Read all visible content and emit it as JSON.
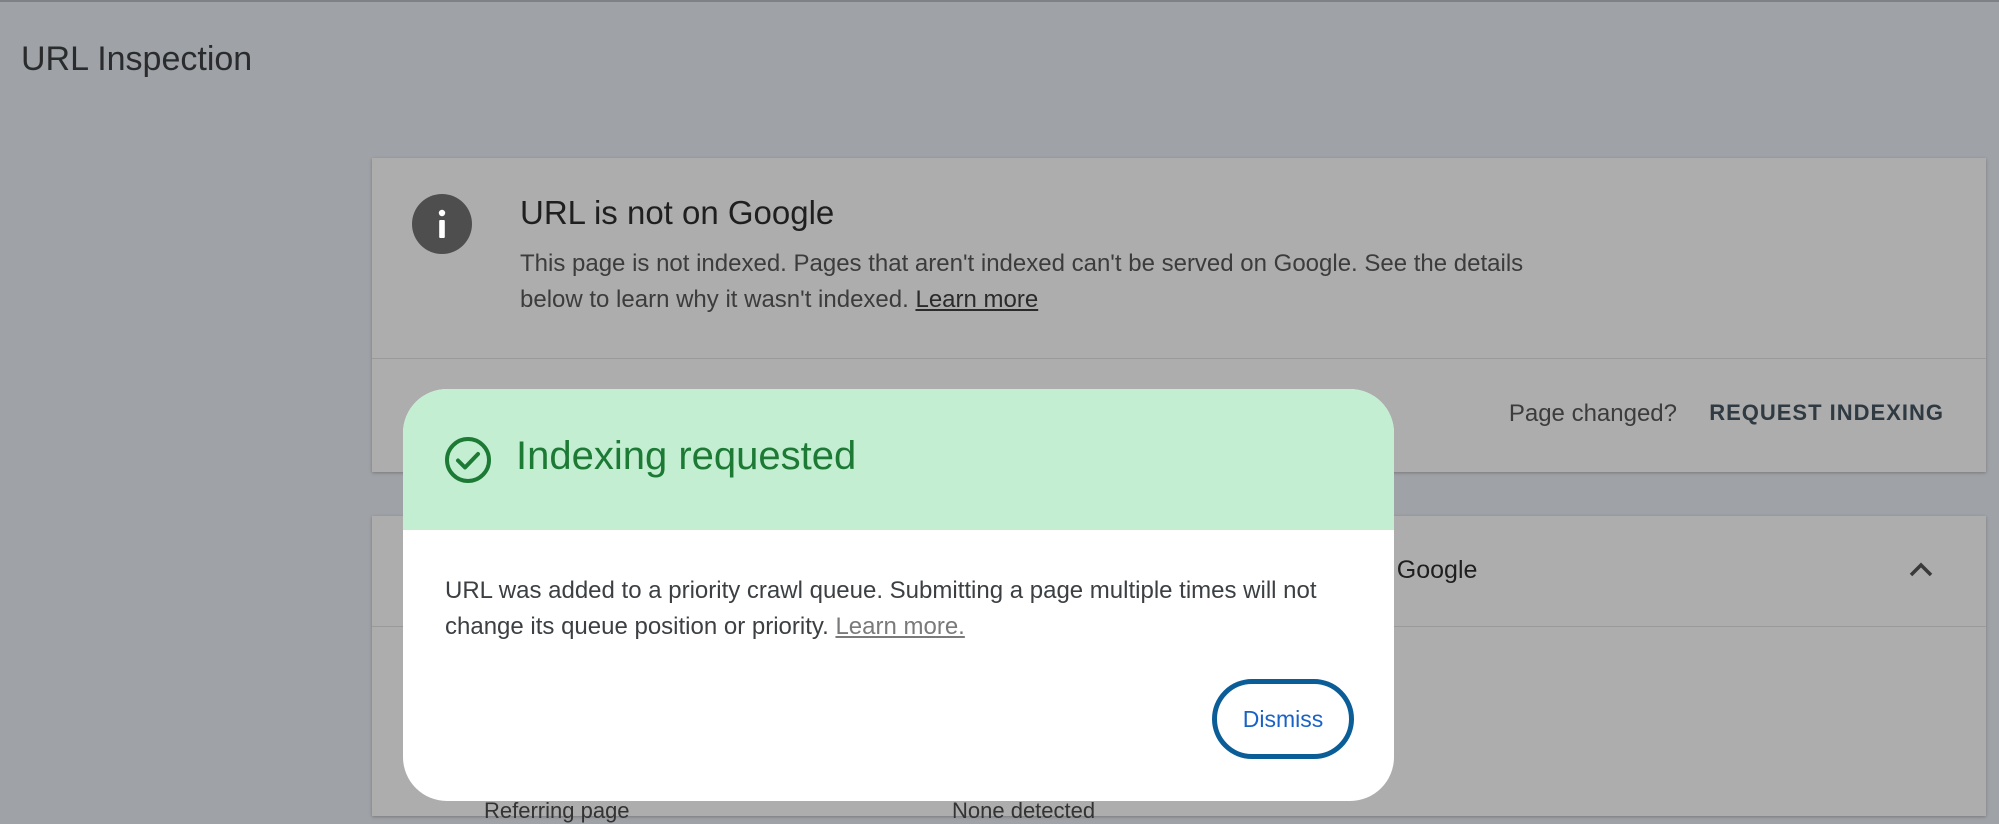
{
  "page": {
    "title": "URL Inspection"
  },
  "status_card": {
    "title": "URL is not on Google",
    "description": "This page is not indexed. Pages that aren't indexed can't be served on Google. See the details below to learn why it wasn't indexed.",
    "learn_more": "Learn more",
    "page_changed": "Page changed?",
    "request_indexing": "REQUEST INDEXING",
    "icon": "info-icon"
  },
  "second_card": {
    "title_fragment": "to Google",
    "bottom_left_fragment": "Referring page",
    "bottom_right_fragment": "None detected",
    "icon": "chevron-up-icon"
  },
  "dialog": {
    "title": "Indexing requested",
    "body": "URL was added to a priority crawl queue. Submitting a page multiple times will not change its queue position or priority.",
    "learn_more": "Learn more.",
    "dismiss": "Dismiss",
    "icon": "check-circle-icon",
    "colors": {
      "header_bg": "#c3eed2",
      "title": "#1d7a35",
      "button": "#1a63c6"
    }
  }
}
